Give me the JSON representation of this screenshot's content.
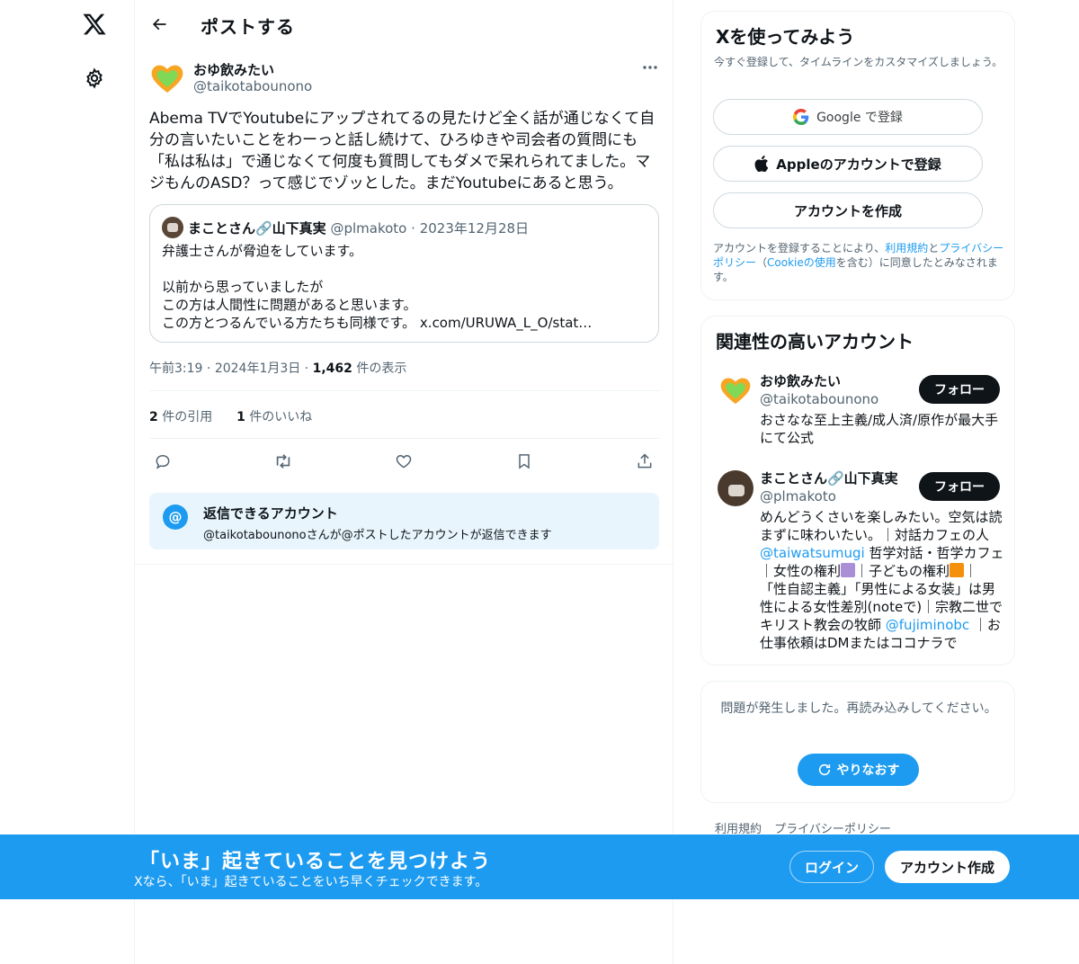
{
  "nav": {
    "logo_icon": "x-logo-icon",
    "settings_icon": "gear-icon"
  },
  "header": {
    "title": "ポストする",
    "back_icon": "arrow-left-icon"
  },
  "post": {
    "author_name": "おゆ飲みたい",
    "author_handle": "@taikotabounono",
    "text": "Abema TVでYoutubeにアップされてるの見たけど全く話が通じなくて自分の言いたいことをわーっと話し続けて、ひろゆきや司会者の質問にも「私は私は」で通じなくて何度も質問してもダメで呆れられてました。マジもんのASD？って感じでゾッとした。まだYoutubeにあると思う。",
    "quote": {
      "name": "まことさん🔗山下真実",
      "handle": "@plmakoto",
      "dot": "·",
      "date": "2023年12月28日",
      "body": "弁護士さんが脅迫をしています。\n\n以前から思っていましたが\nこの方は人間性に問題があると思います。\nこの方とつるんでいる方たちも同様です。 x.com/URUWA_L_O/stat…"
    },
    "time": "午前3:19",
    "date": "2024年1月3日",
    "sep": "·",
    "views_count": "1,462",
    "views_label": "件の表示",
    "quotes_count": "2",
    "quotes_label": "件の引用",
    "likes_count": "1",
    "likes_label": "件のいいね",
    "actions": [
      "reply-icon",
      "retweet-icon",
      "like-icon",
      "bookmark-icon",
      "share-icon"
    ],
    "reply_restriction": {
      "icon": "@",
      "title": "返信できるアカウント",
      "desc": "@taikotabounonoさんが@ポストしたアカウントが返信できます"
    }
  },
  "signup": {
    "title": "Xを使ってみよう",
    "subtitle": "今すぐ登録して、タイムラインをカスタマイズしましょう。",
    "google_label": "Google で登録",
    "apple_label": "Appleのアカウントで登録",
    "create_label": "アカウントを作成",
    "legal_1": "アカウントを登録することにより、",
    "legal_terms": "利用規約",
    "legal_and": "と",
    "legal_privacy": "プライバシーポリシー",
    "legal_2": "（",
    "legal_cookie": "Cookieの使用",
    "legal_3": "を含む）に同意したとみなされます。"
  },
  "related": {
    "title": "関連性の高いアカウント",
    "follow_label": "フォロー",
    "accounts": [
      {
        "name": "おゆ飲みたい",
        "handle": "@taikotabounono",
        "bio": "おさなな至上主義/成人済/原作が最大手にて公式"
      },
      {
        "name": "まことさん🔗山下真実",
        "handle": "@plmakoto",
        "bio_1": "めんどうくさいを楽しみたい。空気は読まずに味わいたい。｜対話カフェの人 ",
        "bio_link1": "@taiwatsumugi",
        "bio_2": " 哲学対話・哲学カフェ ｜女性の権利",
        "bio_3": "｜子どもの権利",
        "bio_4": "｜「性自認主義」「男性による女装」は男性による女性差別(noteで)｜宗教二世でキリスト教会の牧師 ",
        "bio_link2": "@fujiminobc",
        "bio_5": " ｜お仕事依頼はDMまたはココナラで"
      }
    ]
  },
  "error": {
    "text": "問題が発生しました。再読み込みしてください。",
    "retry_label": "やりなおす"
  },
  "footer": {
    "links": [
      "利用規約",
      "プライバシーポリシー"
    ]
  },
  "banner": {
    "title": "「いま」起きていることを見つけよう",
    "subtitle": "Xなら、「いま」起きていることをいち早くチェックできます。",
    "login_label": "ログイン",
    "signup_label": "アカウント作成"
  },
  "colors": {
    "accent": "#1d9bf0",
    "text": "#0f1419",
    "muted": "#536471",
    "border": "#eff3f4"
  }
}
